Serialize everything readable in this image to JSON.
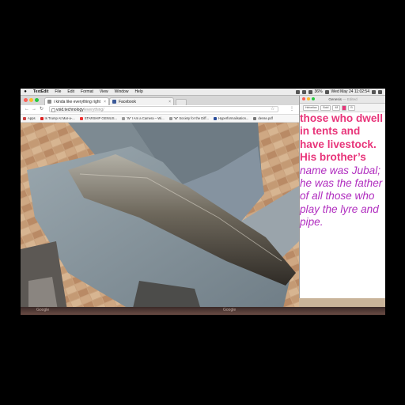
{
  "menubar": {
    "app": "TextEdit",
    "items": [
      "File",
      "Edit",
      "Format",
      "View",
      "Window",
      "Help"
    ],
    "clock": "Wed May 24  11:02:54",
    "battery": "36%"
  },
  "browser": {
    "tabs": [
      {
        "label": "i kinda like everything right",
        "favicon": "#8a8a8a"
      },
      {
        "label": "Facebook",
        "favicon": "#3b5998"
      }
    ],
    "url_host": "void.technology",
    "url_path": "/everything/",
    "bookmarks": [
      {
        "label": "Apps",
        "color": "#c44"
      },
      {
        "label": "Is Trump At Mar-a-...",
        "color": "#d22"
      },
      {
        "label": "STARSHIP GENIUS...",
        "color": "#e33"
      },
      {
        "label": "'W' I Am a Camera – Wi...",
        "color": "#999"
      },
      {
        "label": "'W' Society for the Diff...",
        "color": "#999"
      },
      {
        "label": "Hyperformalisation...",
        "color": "#2a4d9b"
      },
      {
        "label": "dense.pdf",
        "color": "#777"
      }
    ]
  },
  "textedit": {
    "title": "Genesis",
    "title_suffix": "— Edited",
    "font_style": "Helvetica",
    "weight": "Bold",
    "size": "48",
    "text_bold": "those who dwell in tents and have livestock. His brother’s",
    "text_italic": "name was Jubal; he was the father of all those who play the lyre and pipe.",
    "color_bold": "#e8357a",
    "color_italic": "#b02dbf"
  },
  "dock": {
    "left_label": "Google",
    "right_label": "Google"
  }
}
